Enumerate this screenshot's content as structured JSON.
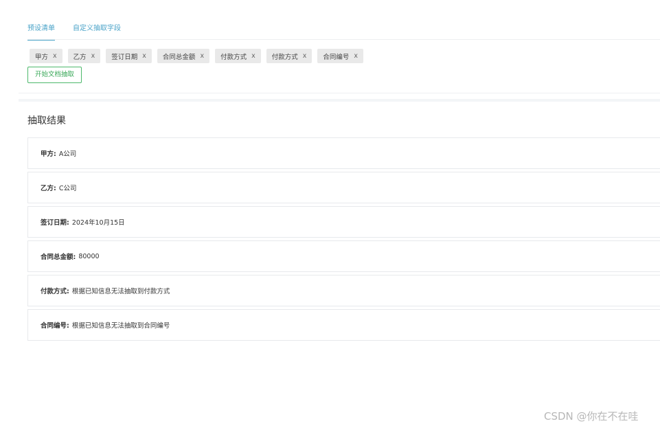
{
  "tabs": [
    {
      "label": "预设清单",
      "active": true
    },
    {
      "label": "自定义抽取字段",
      "active": false
    }
  ],
  "tags": [
    {
      "label": "甲方",
      "close": "x"
    },
    {
      "label": "乙方",
      "close": "x"
    },
    {
      "label": "签订日期",
      "close": "x"
    },
    {
      "label": "合同总金额",
      "close": "x"
    },
    {
      "label": "付款方式",
      "close": "x"
    },
    {
      "label": "付款方式",
      "close": "x"
    },
    {
      "label": "合同编号",
      "close": "x"
    }
  ],
  "start_button": "开始文档抽取",
  "results": {
    "title": "抽取结果",
    "items": [
      {
        "key": "甲方:",
        "value": "A公司"
      },
      {
        "key": "乙方:",
        "value": "C公司"
      },
      {
        "key": "签订日期:",
        "value": "2024年10月15日"
      },
      {
        "key": "合同总金额:",
        "value": "80000"
      },
      {
        "key": "付款方式:",
        "value": "根据已知信息无法抽取到付款方式"
      },
      {
        "key": "合同编号:",
        "value": "根据已知信息无法抽取到合同编号"
      }
    ]
  },
  "watermark": "CSDN @你在不在哇",
  "colors": {
    "accent": "#4aa3c8",
    "button_green": "#3aa859"
  }
}
